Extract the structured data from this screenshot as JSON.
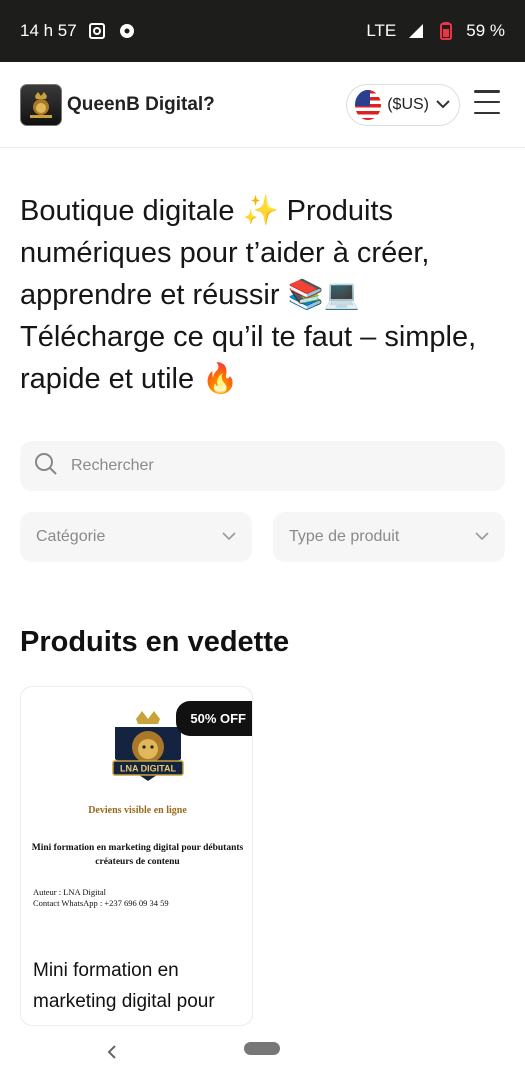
{
  "status": {
    "time": "14 h 57",
    "network": "LTE",
    "battery": "59 %"
  },
  "header": {
    "brand": "QueenB Digital?",
    "currency": "($US)"
  },
  "hero": {
    "text": "Boutique digitale ✨ Produits numériques pour t’aider à créer, apprendre et réussir 📚💻 Télécharge ce qu’il te faut – simple, rapide et utile 🔥"
  },
  "search": {
    "placeholder": "Rechercher"
  },
  "filters": {
    "category": "Catégorie",
    "type": "Type de produit"
  },
  "featured": {
    "title": "Produits en vedette",
    "card": {
      "badge": "50% OFF",
      "cover_brand": "LNA DIGITAL",
      "cover_tagline": "Deviens visible en ligne",
      "cover_title": "Mini formation en marketing digital pour débutants créateurs de contenu",
      "cover_author": "Auteur : LNA Digital",
      "cover_contact": "Contact WhatsApp : +237 696 09 34 59",
      "title": "Mini formation en marketing digital pour"
    }
  },
  "colors": {
    "statusbar": "#1d1d1b",
    "gold": "#c8a23a",
    "badge": "#111111"
  }
}
